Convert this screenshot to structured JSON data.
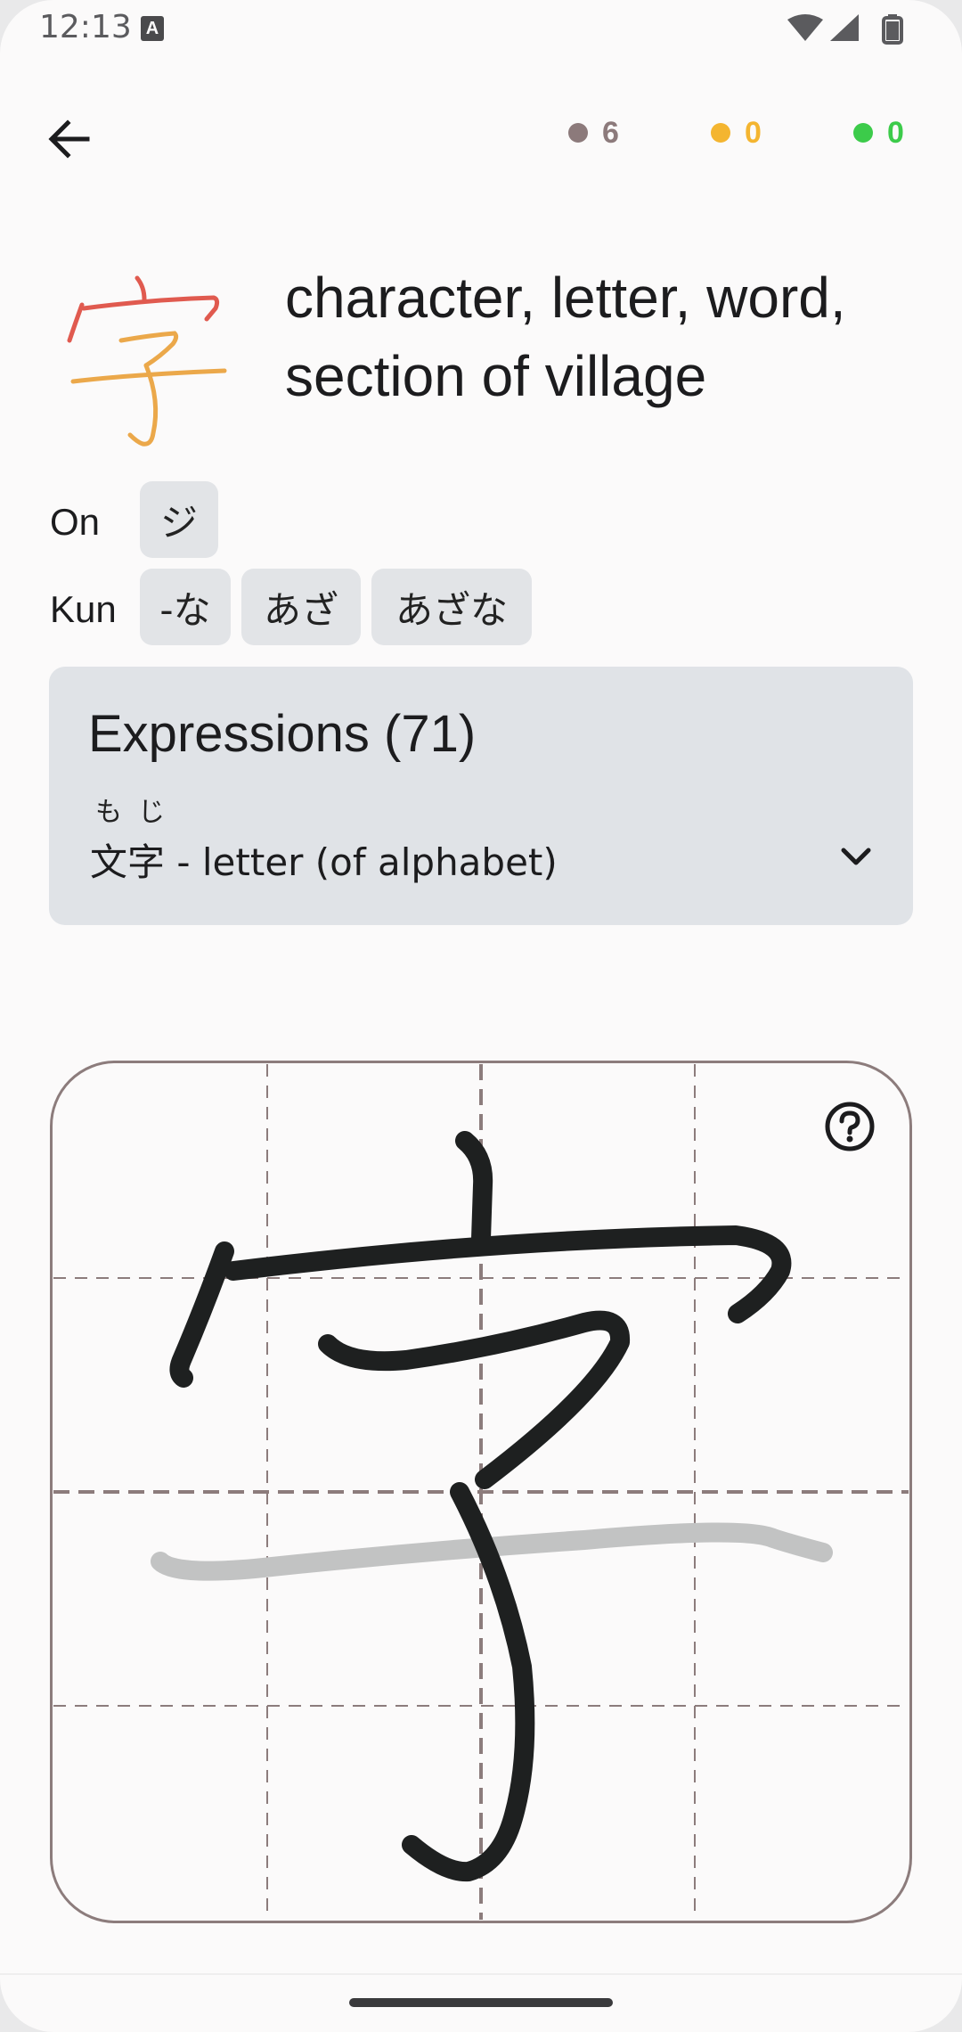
{
  "status_bar": {
    "time": "12:13",
    "keyboard_icon": "A"
  },
  "header": {
    "back_icon": "arrow-left-icon",
    "counters": [
      {
        "value": "6",
        "color": "#8c7a7b"
      },
      {
        "value": "0",
        "color": "#f4b530"
      },
      {
        "value": "0",
        "color": "#3ccb4a"
      }
    ]
  },
  "kanji": {
    "character": "字",
    "meaning": "character, letter, word, section of village"
  },
  "readings": {
    "on_label": "On",
    "on": [
      "ジ"
    ],
    "kun_label": "Kun",
    "kun": [
      "-な",
      "あざ",
      "あざな"
    ]
  },
  "expressions": {
    "title": "Expressions (71)",
    "furigana": "もじ",
    "word": "文字",
    "separator": " - ",
    "meaning": "letter (of alphabet)",
    "chevron_icon": "chevron-down-icon"
  },
  "canvas": {
    "help_icon": "help-circle-icon"
  },
  "colors": {
    "stroke_ink": "#1e2020",
    "stroke_hint": "#c2c3c3",
    "kanji_red": "#e05a4f",
    "kanji_orange": "#eba84a",
    "card_bg": "#e0e3e7",
    "grid": "#8c7c7c"
  }
}
